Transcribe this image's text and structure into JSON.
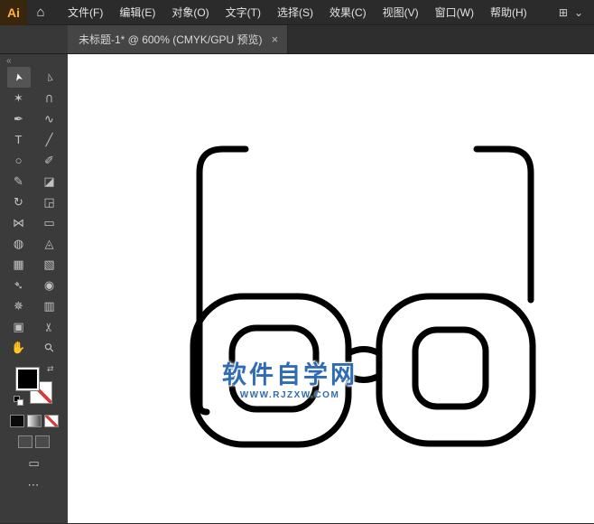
{
  "window": {
    "logo_label": "Ai"
  },
  "icons": {
    "home": "⌂",
    "arrange_documents": "⊞",
    "chevron_down": "⌄"
  },
  "menu": {
    "items": [
      {
        "label": "文件(F)"
      },
      {
        "label": "编辑(E)"
      },
      {
        "label": "对象(O)"
      },
      {
        "label": "文字(T)"
      },
      {
        "label": "选择(S)"
      },
      {
        "label": "效果(C)"
      },
      {
        "label": "视图(V)"
      },
      {
        "label": "窗口(W)"
      },
      {
        "label": "帮助(H)"
      }
    ]
  },
  "tabbar": {
    "tab_title": "未标题-1* @ 600% (CMYK/GPU 预览)",
    "close_label": "×"
  },
  "toolbar": {
    "collapse_label": "«",
    "swap_label": "⇄",
    "screen_mode_label": "▭",
    "more_label": "⋯",
    "fill_color": "#000000",
    "stroke_setting": "none",
    "tools": [
      {
        "name": "selection",
        "glyph": "➤"
      },
      {
        "name": "direct-selection",
        "glyph": "▻"
      },
      {
        "name": "magic-wand",
        "glyph": "✶"
      },
      {
        "name": "lasso",
        "glyph": "⊃"
      },
      {
        "name": "pen",
        "glyph": "✒"
      },
      {
        "name": "curvature",
        "glyph": "∿"
      },
      {
        "name": "type",
        "glyph": "T"
      },
      {
        "name": "line-segment",
        "glyph": "╱"
      },
      {
        "name": "ellipse",
        "glyph": "○"
      },
      {
        "name": "paintbrush",
        "glyph": "✐"
      },
      {
        "name": "pencil",
        "glyph": "✎"
      },
      {
        "name": "eraser",
        "glyph": "◪"
      },
      {
        "name": "rotate",
        "glyph": "↻"
      },
      {
        "name": "scale",
        "glyph": "◲"
      },
      {
        "name": "width",
        "glyph": "⋈"
      },
      {
        "name": "free-transform",
        "glyph": "▭"
      },
      {
        "name": "shape-builder",
        "glyph": "◍"
      },
      {
        "name": "perspective-grid",
        "glyph": "◬"
      },
      {
        "name": "mesh",
        "glyph": "▦"
      },
      {
        "name": "gradient",
        "glyph": "▧"
      },
      {
        "name": "eyedropper",
        "glyph": "➴"
      },
      {
        "name": "blend",
        "glyph": "◉"
      },
      {
        "name": "symbol-sprayer",
        "glyph": "✵"
      },
      {
        "name": "column-graph",
        "glyph": "▥"
      },
      {
        "name": "artboard",
        "glyph": "▣"
      },
      {
        "name": "slice",
        "glyph": "✂"
      },
      {
        "name": "hand",
        "glyph": "✋"
      },
      {
        "name": "zoom",
        "glyph": "⚲"
      }
    ]
  },
  "watermark": {
    "title": "软件自学网",
    "url": "WWW.RJZXW.COM",
    "color": "#2f6cb5"
  },
  "artwork": {
    "description": "glasses outline drawing",
    "stroke_color": "#000000"
  }
}
